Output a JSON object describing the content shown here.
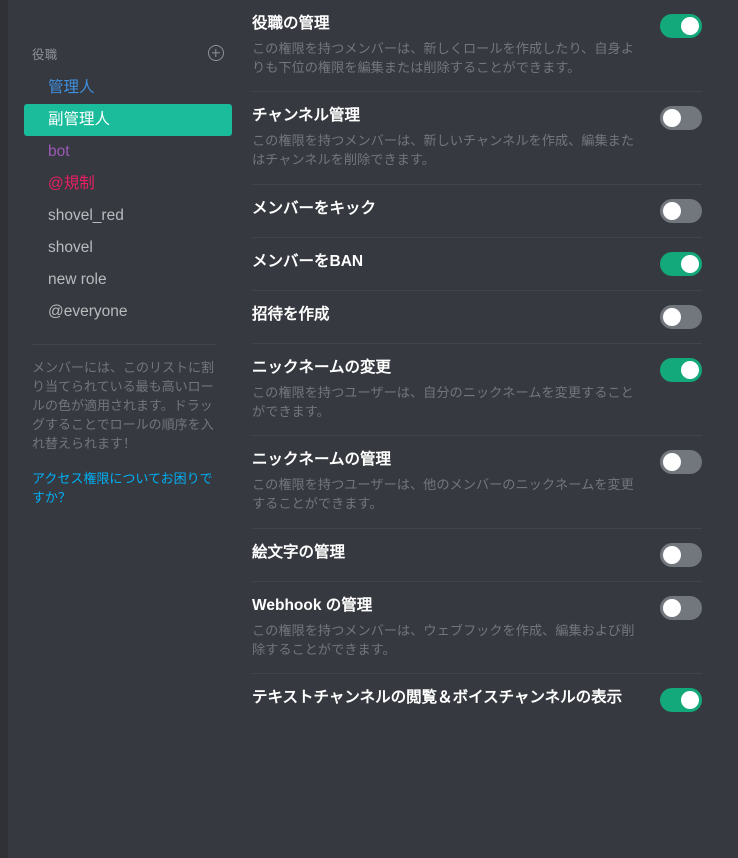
{
  "sidebar": {
    "header": {
      "title": "役職",
      "add_icon": "plus-circle-icon"
    },
    "roles": [
      {
        "label": "管理人",
        "color": "#3f8fde",
        "selected": false
      },
      {
        "label": "副管理人",
        "color": "#ffffff",
        "selected": true
      },
      {
        "label": "bot",
        "color": "#9b59b6",
        "selected": false
      },
      {
        "label": "@規制",
        "color": "#e91e63",
        "selected": false
      },
      {
        "label": "shovel_red",
        "color": "#b9bbbe",
        "selected": false
      },
      {
        "label": "shovel",
        "color": "#b9bbbe",
        "selected": false
      },
      {
        "label": "new role",
        "color": "#b9bbbe",
        "selected": false
      },
      {
        "label": "@everyone",
        "color": "#b9bbbe",
        "selected": false
      }
    ],
    "note": "メンバーには、このリストに割り当てられている最も高いロールの色が適用されます。ドラッグすることでロールの順序を入れ替えられます！",
    "help_link": "アクセス権限についてお困りですか？"
  },
  "permissions": [
    {
      "title": "役職の管理",
      "description": "この権限を持つメンバーは、新しくロールを作成したり、自身よりも下位の権限を編集または削除することができます。",
      "enabled": true
    },
    {
      "title": "チャンネル管理",
      "description": "この権限を持つメンバーは、新しいチャンネルを作成、編集またはチャンネルを削除できます。",
      "enabled": false
    },
    {
      "title": "メンバーをキック",
      "description": "",
      "enabled": false
    },
    {
      "title": "メンバーをBAN",
      "description": "",
      "enabled": true
    },
    {
      "title": "招待を作成",
      "description": "",
      "enabled": false
    },
    {
      "title": "ニックネームの変更",
      "description": "この権限を持つユーザーは、自分のニックネームを変更することができます。",
      "enabled": true
    },
    {
      "title": "ニックネームの管理",
      "description": "この権限を持つユーザーは、他のメンバーのニックネームを変更することができます。",
      "enabled": false
    },
    {
      "title": "絵文字の管理",
      "description": "",
      "enabled": false
    },
    {
      "title": "Webhook の管理",
      "description": "この権限を持つメンバーは、ウェブフックを作成、編集および削除することができます。",
      "enabled": false
    },
    {
      "title": "テキストチャンネルの閲覧＆ボイスチャンネルの表示",
      "description": "",
      "enabled": true
    }
  ],
  "colors": {
    "background": "#36393f",
    "edge": "#2f3136",
    "toggle_on": "#13a97a",
    "toggle_off": "#72767d",
    "selected_role": "#1abc9c",
    "link": "#00aff4",
    "divider": "#41454b"
  }
}
